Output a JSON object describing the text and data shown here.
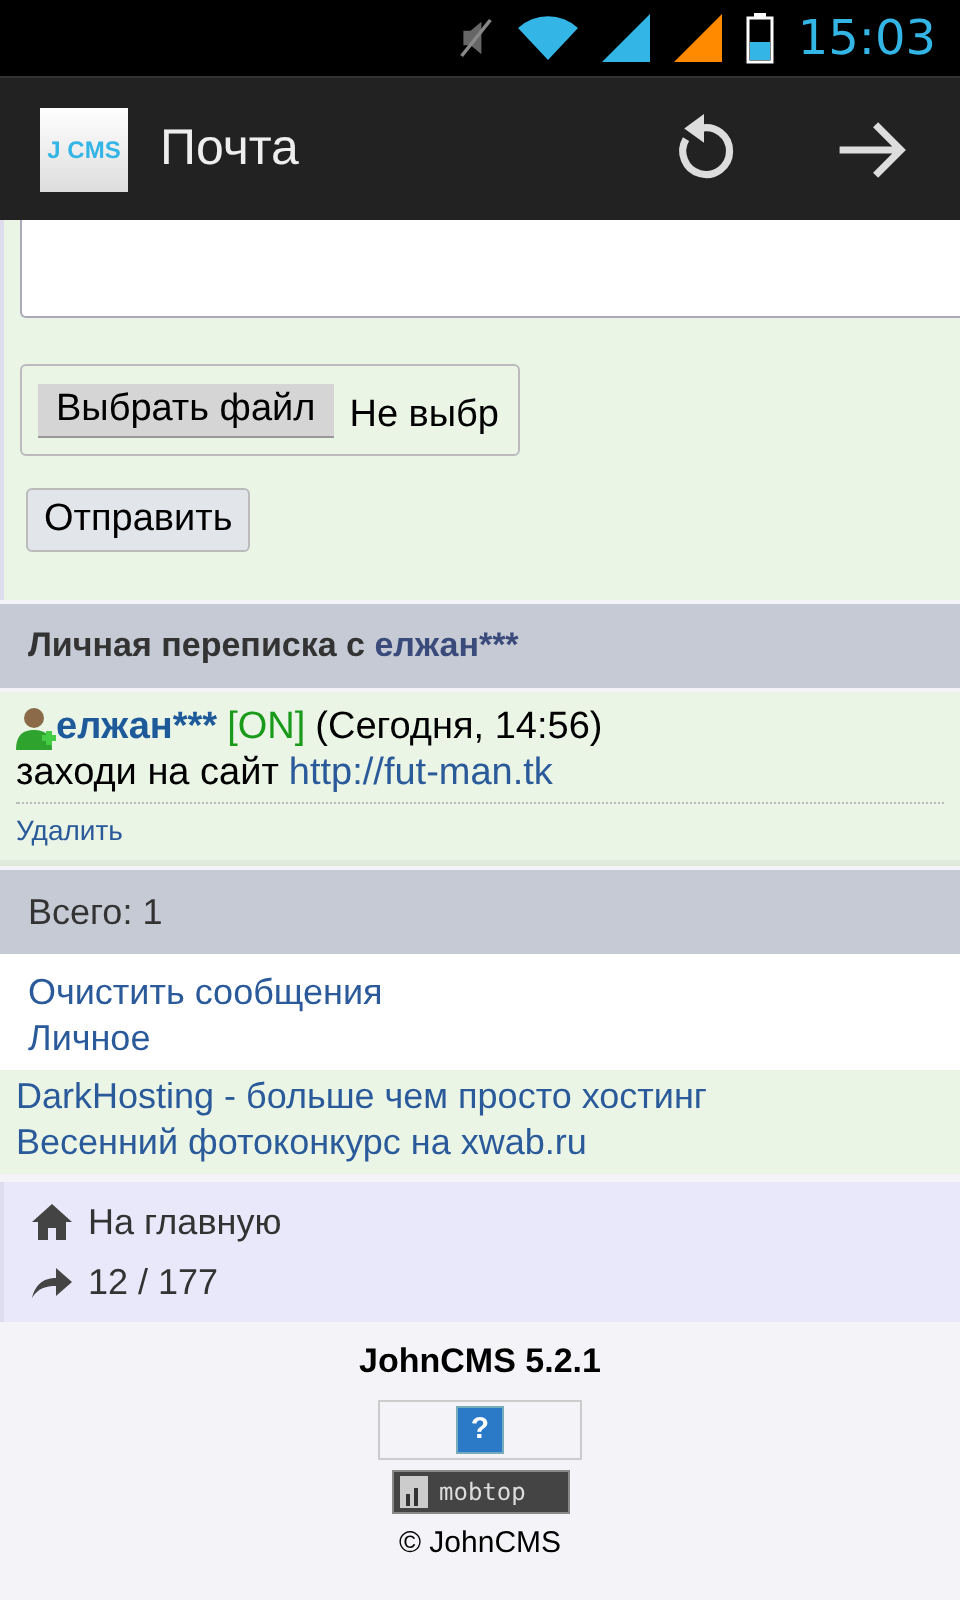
{
  "status_bar": {
    "time": "15:03"
  },
  "app_bar": {
    "logo": "J CMS",
    "title": "Почта"
  },
  "form": {
    "file_button": "Выбрать файл",
    "file_status": "Не выбр",
    "send_button": "Отправить"
  },
  "thread_header": {
    "prefix": "Личная переписка с",
    "user": "елжан***"
  },
  "messages": [
    {
      "author": "елжан***",
      "online": "[ON]",
      "time": "(Сегодня, 14:56)",
      "text": "заходи на сайт",
      "link": "http://fut-man.tk",
      "delete": "Удалить"
    }
  ],
  "total": "Всего: 1",
  "actions": [
    "Очистить сообщения",
    "Личное"
  ],
  "ads": [
    "DarkHosting - больше чем просто хостинг",
    "Весенний фотоконкурс на xwab.ru"
  ],
  "nav": [
    {
      "kind": "home",
      "label": "На главную"
    },
    {
      "kind": "counter",
      "label": "12 / 177"
    }
  ],
  "footer": {
    "version": "JohnCMS 5.2.1",
    "help_badge": "?",
    "counter_badge": "mobtop",
    "copyright": "© JohnCMS"
  }
}
